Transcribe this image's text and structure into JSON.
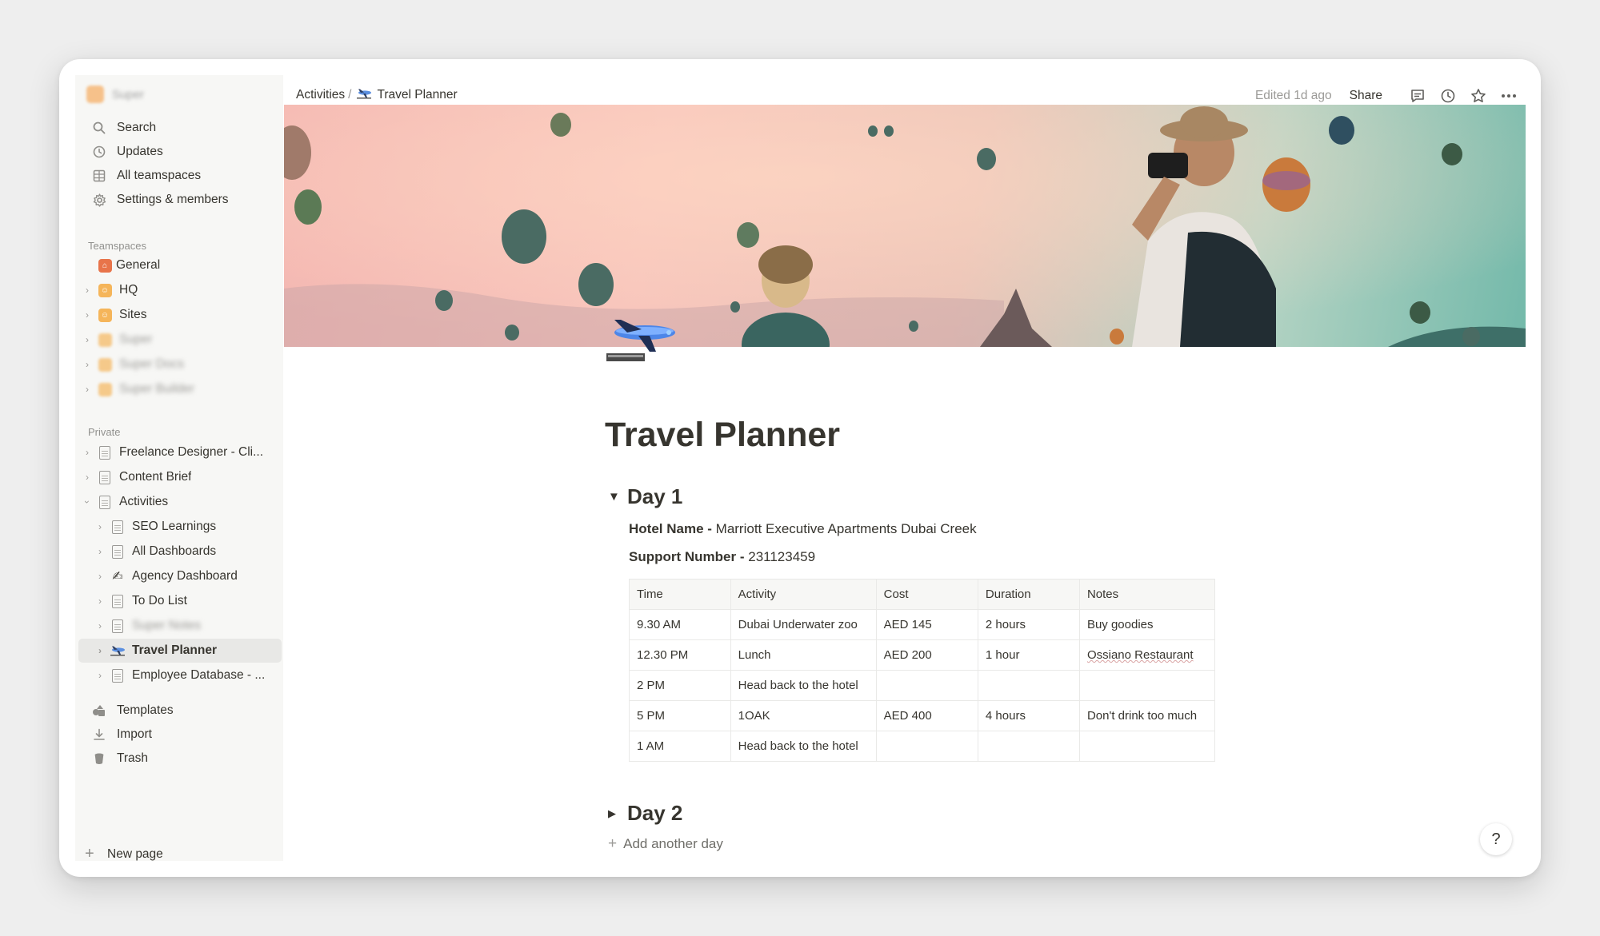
{
  "workspace": {
    "name": "Super"
  },
  "sidebar": {
    "nav": [
      {
        "label": "Search",
        "icon": "search-icon"
      },
      {
        "label": "Updates",
        "icon": "clock-icon"
      },
      {
        "label": "All teamspaces",
        "icon": "grid-icon"
      },
      {
        "label": "Settings & members",
        "icon": "gear-icon"
      }
    ],
    "teamspaces_label": "Teamspaces",
    "teamspaces": [
      {
        "label": "General",
        "color": "#e8744a"
      },
      {
        "label": "HQ",
        "color": "#f5b55a"
      },
      {
        "label": "Sites",
        "color": "#f5b55a"
      },
      {
        "label": "Super",
        "color": "#f5b55a"
      },
      {
        "label": "Super Docs",
        "color": "#f5b55a"
      },
      {
        "label": "Super Builder",
        "color": "#f5b55a"
      }
    ],
    "private_label": "Private",
    "private": [
      {
        "label": "Freelance Designer - Cli..."
      },
      {
        "label": "Content Brief"
      },
      {
        "label": "Activities"
      },
      {
        "label": "SEO Learnings"
      },
      {
        "label": "All Dashboards"
      },
      {
        "label": "Agency Dashboard"
      },
      {
        "label": "To Do List"
      },
      {
        "label": "Super Notes"
      },
      {
        "label": "Travel Planner"
      },
      {
        "label": "Employee Database - ..."
      }
    ],
    "footer": [
      {
        "label": "Templates"
      },
      {
        "label": "Import"
      },
      {
        "label": "Trash"
      }
    ],
    "new_page": "New page"
  },
  "topbar": {
    "breadcrumb_parent": "Activities",
    "breadcrumb_sep": "/",
    "breadcrumb_current": "Travel Planner",
    "edited": "Edited 1d ago",
    "share": "Share"
  },
  "page": {
    "title": "Travel Planner",
    "day1": {
      "heading": "Day 1",
      "hotel_label": "Hotel Name -",
      "hotel_value": "Marriott Executive Apartments Dubai Creek",
      "support_label": "Support Number -",
      "support_value": "231123459",
      "table": {
        "headers": [
          "Time",
          "Activity",
          "Cost",
          "Duration",
          "Notes"
        ],
        "rows": [
          [
            "9.30 AM",
            "Dubai Underwater zoo",
            "AED 145",
            "2 hours",
            "Buy goodies"
          ],
          [
            "12.30 PM",
            "Lunch",
            "AED 200",
            "1 hour",
            "Ossiano Restaurant"
          ],
          [
            "2 PM",
            "Head back to the hotel",
            "",
            "",
            ""
          ],
          [
            "5 PM",
            "1OAK",
            "AED 400",
            "4 hours",
            "Don't drink too much"
          ],
          [
            "1 AM",
            "Head back to the hotel",
            "",
            "",
            ""
          ]
        ]
      }
    },
    "day2": {
      "heading": "Day 2"
    },
    "add_day": "Add another day"
  },
  "help": "?"
}
